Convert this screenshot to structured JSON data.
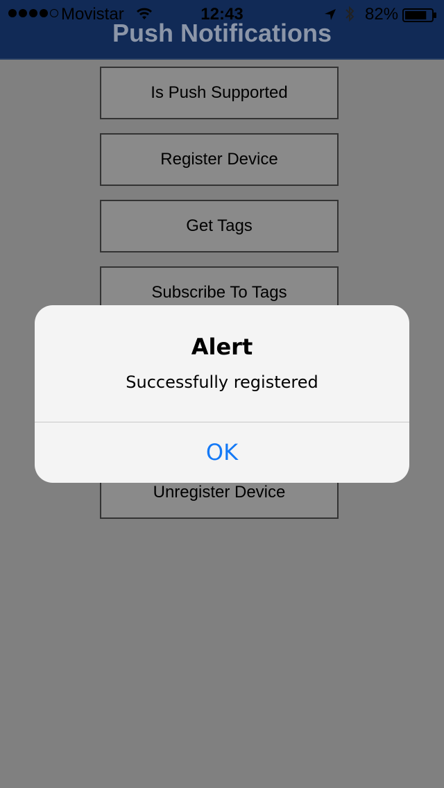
{
  "status_bar": {
    "carrier": "Movistar",
    "time": "12:43",
    "battery_percent": "82%",
    "battery_level": 0.82,
    "signal_bars_filled": 4,
    "signal_bars_total": 5,
    "icons": [
      "wifi-icon",
      "location-arrow-icon",
      "bluetooth-icon",
      "battery-icon"
    ]
  },
  "header": {
    "title": "Push Notifications",
    "background_color": "#112a56"
  },
  "buttons": [
    {
      "label": "Is Push Supported"
    },
    {
      "label": "Register Device"
    },
    {
      "label": "Get Tags"
    },
    {
      "label": "Subscribe To Tags"
    },
    {
      "label": "Unregister Device"
    }
  ],
  "alert": {
    "title": "Alert",
    "message": "Successfully registered",
    "ok_label": "OK",
    "ok_color": "#1479f6"
  }
}
